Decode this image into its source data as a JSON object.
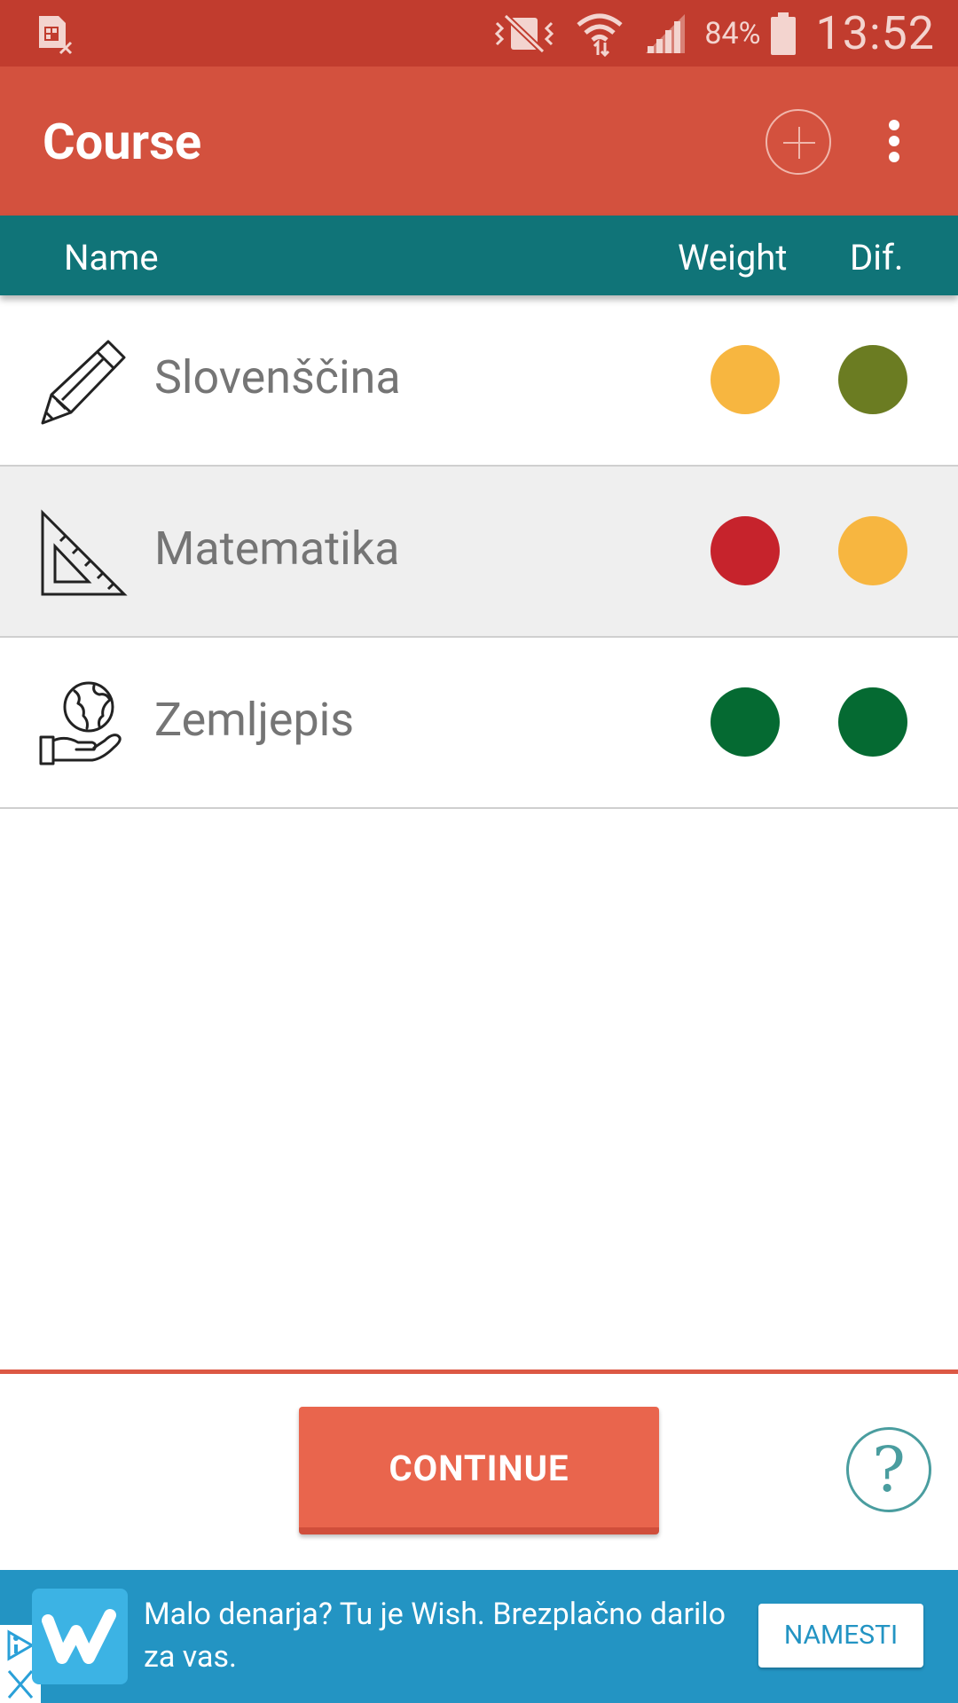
{
  "status_bar": {
    "left_icon": "sim-card-off-icon",
    "icons": [
      "vibrate-mute-icon",
      "wifi-icon",
      "signal-icon",
      "battery-icon"
    ],
    "battery": "84%",
    "time": "13:52"
  },
  "app_bar": {
    "title": "Course",
    "add_icon": "add-circle-icon",
    "menu_icon": "more-vert-icon"
  },
  "columns": {
    "name": "Name",
    "weight": "Weight",
    "dif": "Dif."
  },
  "courses": [
    {
      "name": "Slovenščina",
      "icon": "pencil-icon",
      "weight_color": "#f7b640",
      "dif_color": "#6b7c22"
    },
    {
      "name": "Matematika",
      "icon": "set-square-icon",
      "weight_color": "#c6232c",
      "dif_color": "#f7b640"
    },
    {
      "name": "Zemljepis",
      "icon": "globe-in-hand-icon",
      "weight_color": "#056a32",
      "dif_color": "#056a32"
    }
  ],
  "actions": {
    "continue_label": "CONTINUE",
    "help_label": "?"
  },
  "ad": {
    "logo": "w",
    "text": "Malo denarja? Tu je Wish. Brezplačno darilo za vas.",
    "cta": "NAMESTI"
  },
  "colors": {
    "status_bar": "#c13c2e",
    "app_bar": "#d3513e",
    "column_header": "#107478",
    "continue": "#e9654d",
    "ad_background": "#2394c3"
  }
}
